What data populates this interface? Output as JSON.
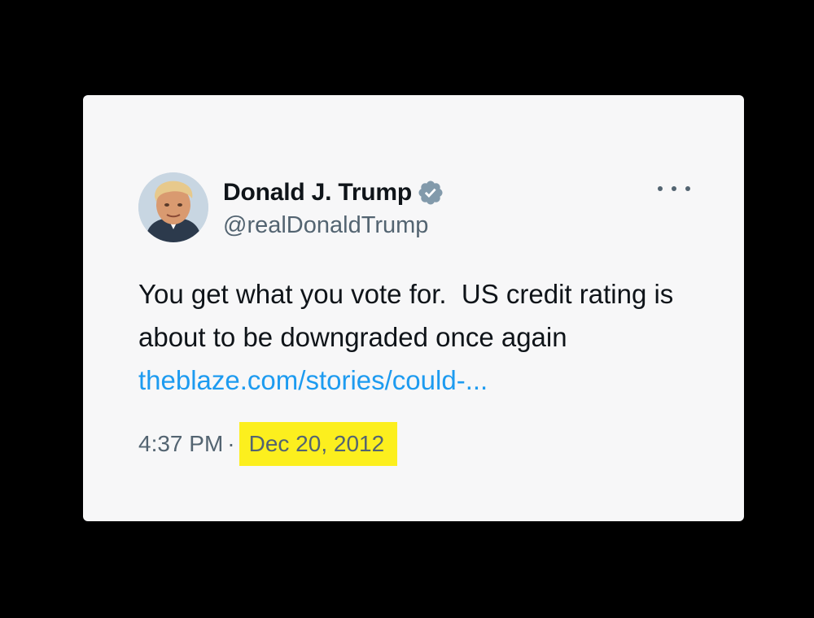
{
  "tweet": {
    "display_name": "Donald J. Trump",
    "handle": "@realDonaldTrump",
    "verified_icon": "verified-badge-icon",
    "more_icon": "more-options-icon",
    "text": "You get what you vote for.  US credit rating is about to be downgraded once again ",
    "link_text": "theblaze.com/stories/could-...",
    "time": "4:37 PM",
    "separator": "·",
    "date": "Dec 20, 2012"
  },
  "colors": {
    "card_background": "#f7f7f8",
    "page_background": "#000000",
    "link": "#1d9bf0",
    "secondary_text": "#536471",
    "primary_text": "#0f1419",
    "highlight": "#fcef1e",
    "verified_badge": "#829aab"
  }
}
